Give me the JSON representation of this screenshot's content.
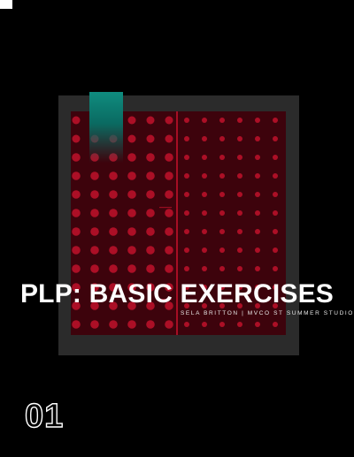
{
  "cover": {
    "title": "PLP: BASIC EXERCISES",
    "subtitle": "SELA BRITTON | MVCO ST SUMMER STUDIO",
    "page_number": "01"
  },
  "colors": {
    "background": "#000000",
    "frame": "#2b2b2b",
    "panel": "#3d030c",
    "dots": "#c0122b",
    "accent_tab": "#0f8c7f",
    "text": "#ffffff"
  }
}
